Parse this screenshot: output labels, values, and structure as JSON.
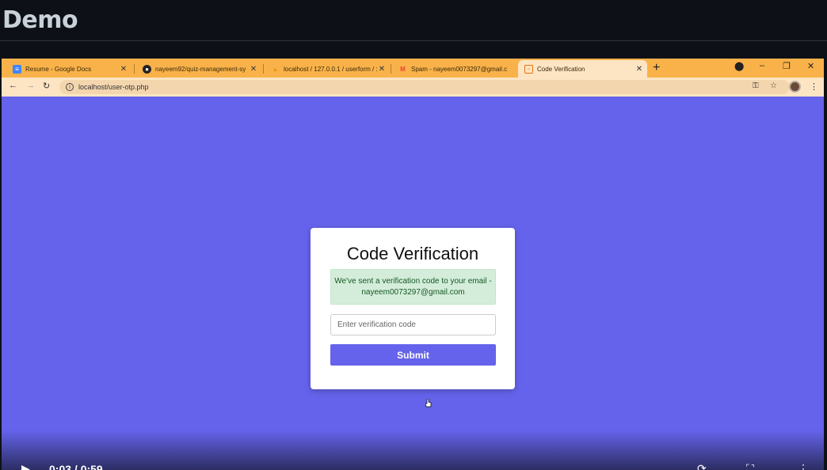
{
  "page": {
    "title": "Demo"
  },
  "browser": {
    "tabs": [
      {
        "label": "Resume - Google Docs",
        "icon": "google-docs-icon",
        "icon_color": "#4285f4",
        "active": false
      },
      {
        "label": "nayeem92/quiz-management-sy",
        "icon": "github-icon",
        "icon_color": "#222222",
        "active": false
      },
      {
        "label": "localhost / 127.0.0.1 / userform / :",
        "icon": "phpmyadmin-icon",
        "icon_color": "#f29111",
        "active": false
      },
      {
        "label": "Spam - nayeem0073297@gmail.c",
        "icon": "gmail-icon",
        "icon_color": "#ea4335",
        "active": false
      },
      {
        "label": "Code Verification",
        "icon": "site-icon",
        "icon_color": "#e8710a",
        "active": true
      }
    ],
    "new_tab": "+",
    "address": "localhost/user-otp.php",
    "accent_color": "#f9b24a"
  },
  "form": {
    "heading": "Code Verification",
    "alert_text": "We've sent a verification code to your email - nayeem0073297@gmail.com",
    "input_placeholder": "Enter verification code",
    "input_value": "",
    "submit_label": "Submit",
    "background_color": "#6563eb"
  },
  "video": {
    "time": "0:03 / 0:59"
  }
}
